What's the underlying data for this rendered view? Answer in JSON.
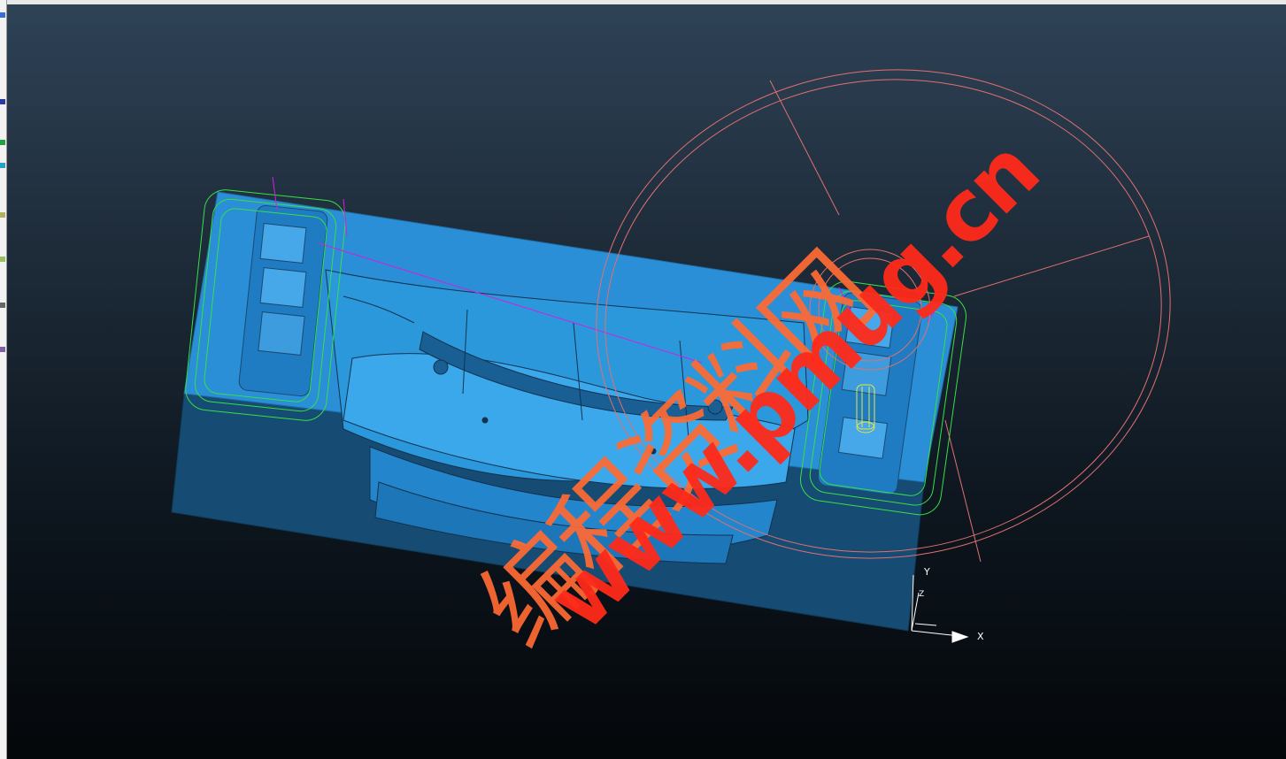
{
  "watermark": {
    "chinese_text": "编程资料网",
    "url_text": "www.pmug.cn"
  },
  "triad": {
    "x_label": "X",
    "y_label": "Y",
    "z_label": "Z"
  },
  "colors": {
    "background_top": "#2e4256",
    "background_bottom": "#04070a",
    "part": "#2a93d8",
    "block_side": "#164c73",
    "toolpath_green": "#36e046",
    "toolpath_magenta": "#d020e0",
    "tool_circle": "#e07070",
    "watermark_cn": "#ff6a33",
    "watermark_url": "#ff2a1a"
  },
  "icons": {
    "triad": "coordinate-triad-icon"
  }
}
